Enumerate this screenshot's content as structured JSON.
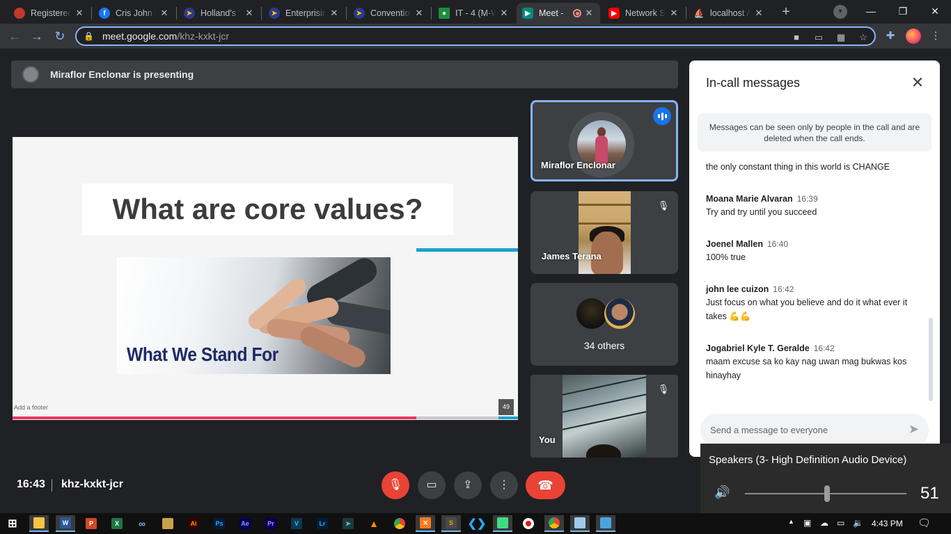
{
  "browser": {
    "tabs": [
      {
        "title": "Registered",
        "favicon": "registered-icon",
        "color": "#c0392b"
      },
      {
        "title": "Cris John n",
        "favicon": "facebook-icon",
        "color": "#1877f2"
      },
      {
        "title": "Holland's T",
        "favicon": "ateneo-icon",
        "color": "#f5c518"
      },
      {
        "title": "Enterprisin",
        "favicon": "ateneo-icon",
        "color": "#f5c518"
      },
      {
        "title": "Convention",
        "favicon": "ateneo-icon",
        "color": "#f5c518"
      },
      {
        "title": "IT - 4 (M-W",
        "favicon": "classroom-icon",
        "color": "#1e8e3e"
      },
      {
        "title": "Meet -",
        "favicon": "meet-icon",
        "color": "#00897b"
      },
      {
        "title": "Network S",
        "favicon": "youtube-icon",
        "color": "#ff0000"
      },
      {
        "title": "localhost /",
        "favicon": "phpmyadmin-icon",
        "color": "#f29111"
      }
    ],
    "url_host": "meet.google.com",
    "url_path": "/khz-kxkt-jcr"
  },
  "meet": {
    "presenting_text": "Miraflor Enclonar is presenting",
    "slide": {
      "title": "What are core values?",
      "photo_caption": "What We Stand For",
      "footer": "Add a footer",
      "page_number": "49"
    },
    "tiles": [
      {
        "name": "Miraflor Enclonar",
        "state": "speaking"
      },
      {
        "name": "James Terana",
        "state": "muted"
      },
      {
        "name": "34 others",
        "state": "group"
      },
      {
        "name": "You",
        "state": "muted"
      }
    ],
    "clock": "16:43",
    "meeting_code": "khz-kxkt-jcr"
  },
  "chat": {
    "title": "In-call messages",
    "notice": "Messages can be seen only by people in the call and are deleted when the call ends.",
    "first_text": "the only constant thing in this world is CHANGE",
    "messages": [
      {
        "sender": "Moana Marie Alvaran",
        "time": "16:39",
        "text": "Try and try until you succeed"
      },
      {
        "sender": "Joenel Mallen",
        "time": "16:40",
        "text": "100% true"
      },
      {
        "sender": "john lee cuizon",
        "time": "16:42",
        "text": "Just focus on what you believe and do it what ever it takes 💪💪"
      },
      {
        "sender": "Jogabriel Kyle T. Geralde",
        "time": "16:42",
        "text": "maam excuse sa ko kay nag uwan mag bukwas kos hinayhay"
      }
    ],
    "input_placeholder": "Send a message to everyone"
  },
  "volume": {
    "device": "Speakers (3- High Definition Audio Device)",
    "level": 51
  },
  "taskbar": {
    "time": "4:43 PM"
  }
}
